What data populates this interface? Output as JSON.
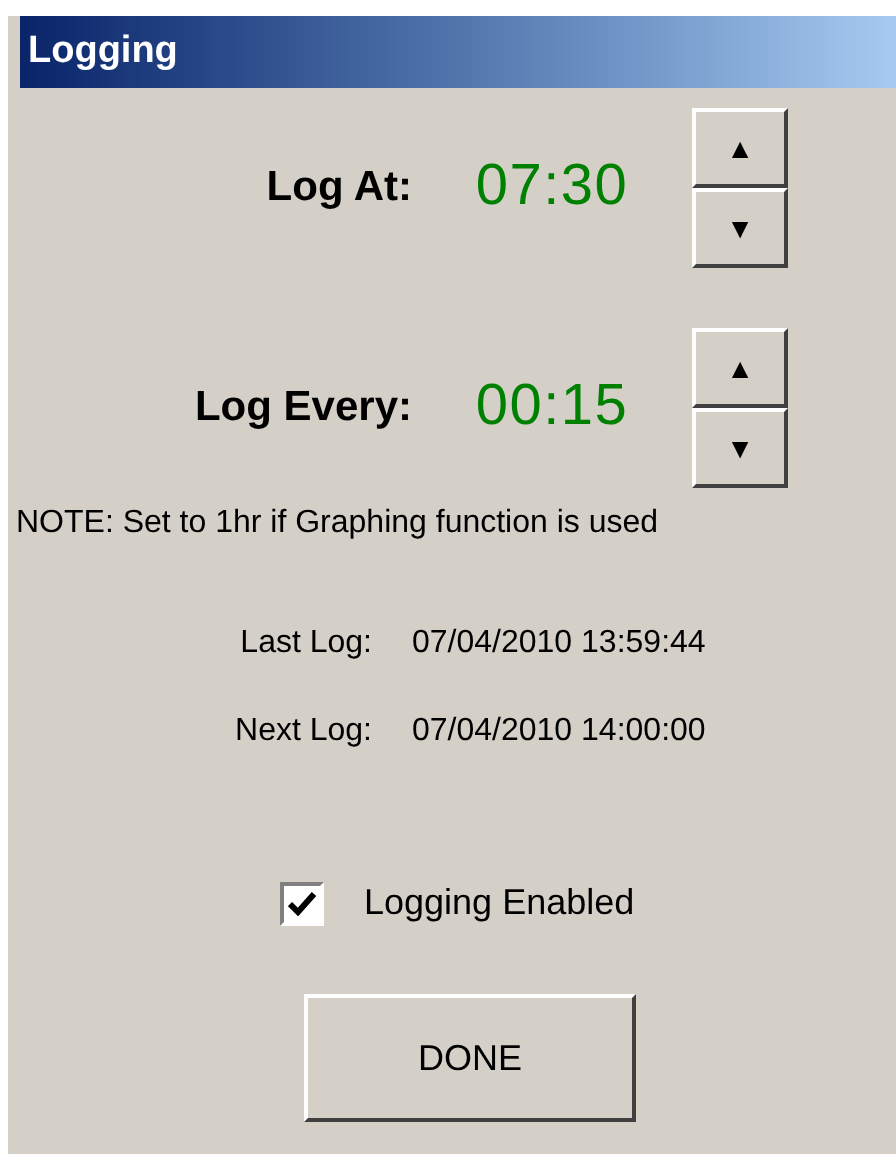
{
  "window": {
    "title": "Logging"
  },
  "spinners": [
    {
      "label": "Log At:",
      "value": "07:30",
      "up": "▲",
      "down": "▼"
    },
    {
      "label": "Log Every:",
      "value": "00:15",
      "up": "▲",
      "down": "▼"
    }
  ],
  "note": "NOTE: Set to 1hr if Graphing function is used",
  "info": [
    {
      "label": "Last Log:",
      "value": "07/04/2010 13:59:44"
    },
    {
      "label": "Next Log:",
      "value": "07/04/2010 14:00:00"
    }
  ],
  "checkbox": {
    "label": "Logging Enabled",
    "checked": true
  },
  "buttons": [
    {
      "label": "DONE"
    }
  ]
}
